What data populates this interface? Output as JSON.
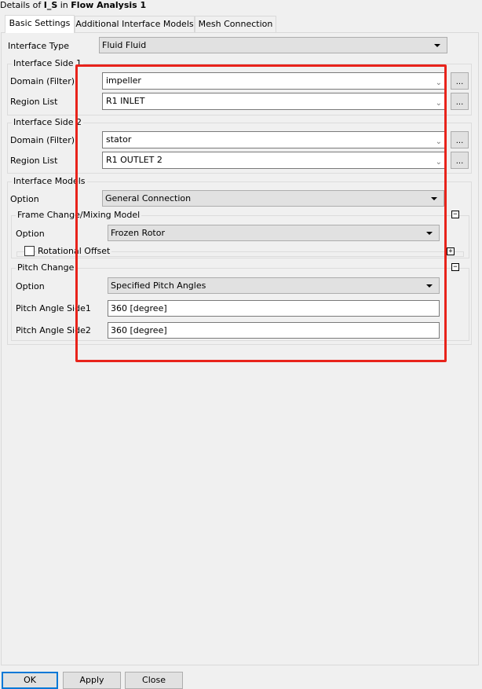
{
  "window": {
    "title_prefix": "Details of ",
    "object_name": "I_S",
    "title_mid": " in ",
    "analysis_name": "Flow Analysis 1"
  },
  "tabs": [
    {
      "label": "Basic Settings",
      "active": true
    },
    {
      "label": "Additional Interface Models",
      "active": false
    },
    {
      "label": "Mesh Connection",
      "active": false
    }
  ],
  "basic": {
    "interface_type": {
      "label": "Interface Type",
      "value": "Fluid Fluid"
    },
    "side1": {
      "title": "Interface Side 1",
      "domain": {
        "label": "Domain (Filter)",
        "value": "impeller"
      },
      "region": {
        "label": "Region List",
        "value": "R1 INLET"
      },
      "browse_label": "..."
    },
    "side2": {
      "title": "Interface Side 2",
      "domain": {
        "label": "Domain (Filter)",
        "value": "stator"
      },
      "region": {
        "label": "Region List",
        "value": "R1 OUTLET 2"
      },
      "browse_label": "..."
    },
    "models": {
      "title": "Interface Models",
      "option": {
        "label": "Option",
        "value": "General Connection"
      },
      "frame_change": {
        "title": "Frame Change/Mixing Model",
        "collapse_glyph": "−",
        "option": {
          "label": "Option",
          "value": "Frozen Rotor"
        },
        "rotational_offset": {
          "label": "Rotational Offset",
          "checked": false,
          "expand_glyph": "+"
        }
      },
      "pitch_change": {
        "title": "Pitch Change",
        "collapse_glyph": "−",
        "option": {
          "label": "Option",
          "value": "Specified Pitch Angles"
        },
        "side1": {
          "label": "Pitch Angle Side1",
          "value": "360 [degree]"
        },
        "side2": {
          "label": "Pitch Angle Side2",
          "value": "360 [degree]"
        }
      }
    }
  },
  "buttons": {
    "ok": "OK",
    "apply": "Apply",
    "close": "Close"
  },
  "colors": {
    "highlight": "#e8231b",
    "focus": "#0078d7"
  }
}
